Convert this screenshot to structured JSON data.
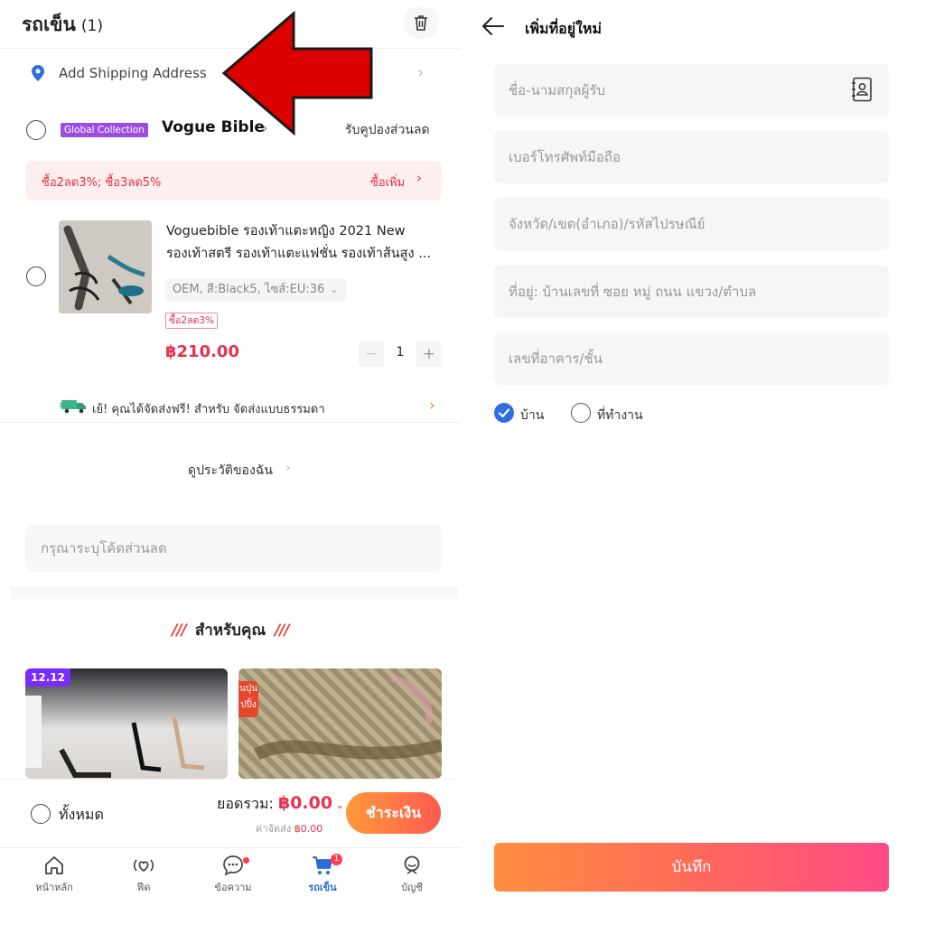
{
  "cart": {
    "title": "รถเข็น",
    "count": "(1)",
    "shipping_address": "Add Shipping Address",
    "store": {
      "badge": "Global Collection",
      "name": "Vogue Bible",
      "coupon_link": "รับคูปองส่วนลด"
    },
    "promo": {
      "text": "ซื้อ2ลด3%;  ซื้อ3ลด5%",
      "more": "ซื้อเพิ่ม"
    },
    "item": {
      "title": "Voguebible รองเท้าแตะหญิง 2021 New รองเท้าสตรี รองเท้าแตะแฟชั่น รองเท้าส้นสูง ...",
      "variant": "OEM, สี:Black5, ไซส์:EU:36",
      "tag": "ซื้อ2ลด3%",
      "price": "฿210.00",
      "quantity": "1"
    },
    "shipping_note": "เย้! คุณได้จัดส่งฟรี! สำหรับ จัดส่งแบบธรรมดา",
    "history_link": "ดูประวัติของฉัน",
    "discount_placeholder": "กรุณาระบุโค้ดส่วนลด",
    "for_you": {
      "title": "สำหรับคุณ",
      "deco": "///"
    },
    "recommend": {
      "badge_1": "12.12",
      "badge_2": "นปุ่น ปปิ้ง"
    },
    "footer": {
      "select_all": "ทั้งหมด",
      "total_label": "ยอดรวม:",
      "total_value": "฿0.00",
      "shipping_fee_label": "ค่าจัดส่ง",
      "shipping_fee_value": "฿0.00",
      "pay_button": "ชำระเงิน"
    },
    "tabs": [
      {
        "label": "หน้าหลัก",
        "icon": "home-icon"
      },
      {
        "label": "ฟีด",
        "icon": "feed-heart-icon"
      },
      {
        "label": "ข้อความ",
        "icon": "chat-icon"
      },
      {
        "label": "รถเข็น",
        "icon": "cart-icon"
      },
      {
        "label": "บัญชี",
        "icon": "account-icon"
      }
    ],
    "cart_badge": "1"
  },
  "address_form": {
    "title": "เพิ่มที่อยู่ใหม่",
    "fields": {
      "name": "ชื่อ-นามสกุลผู้รับ",
      "phone": "เบอร์โทรศัพท์มือถือ",
      "province": "จังหวัด/เขต(อำเภอ)/รหัสไปรษณีย์",
      "address": "ที่อยู่: บ้านเลขที่ ซอย หมู่ ถนน แขวง/ตำบล",
      "building": "เลขที่อาคาร/ชั้น"
    },
    "type_home": "บ้าน",
    "type_work": "ที่ทำงาน",
    "save_button": "บันทึก"
  },
  "colors": {
    "accent_red": "#e6334f",
    "checkbox_blue": "#2e6fe0",
    "arrow_red": "#dd0000",
    "global_badge_purple": "#9d4ee0"
  }
}
